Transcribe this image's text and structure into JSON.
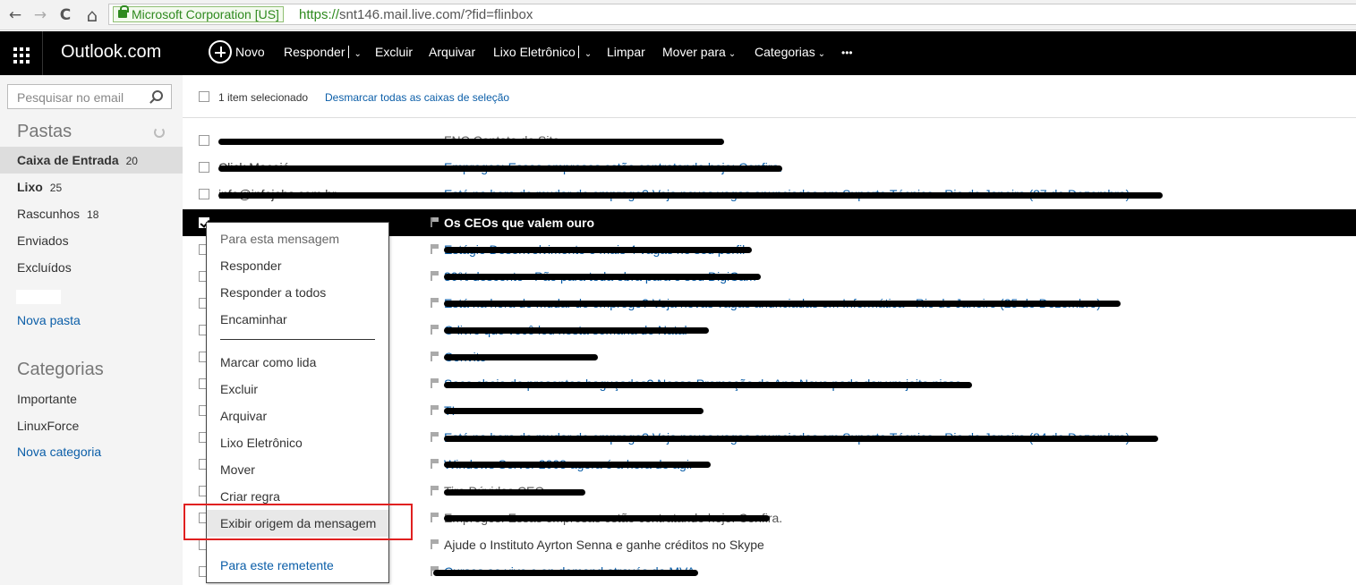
{
  "browser": {
    "back": "←",
    "forward": "→",
    "reload": "C",
    "home": "⌂",
    "secure_label": "Microsoft Corporation [US]",
    "url_scheme": "https://",
    "url_rest": "snt146.mail.live.com/?fid=flinbox"
  },
  "topbar": {
    "brand": "Outlook.com",
    "new": "Novo",
    "reply": "Responder",
    "delete": "Excluir",
    "archive": "Arquivar",
    "junk": "Lixo Eletrônico",
    "sweep": "Limpar",
    "move": "Mover para",
    "categories": "Categorias",
    "more": "•••",
    "chevron": "⌄"
  },
  "sidebar": {
    "search_placeholder": "Pesquisar no email",
    "folders_heading": "Pastas",
    "folders": [
      {
        "label": "Caixa de Entrada",
        "count": "20"
      },
      {
        "label": "Lixo",
        "count": "25"
      },
      {
        "label": "Rascunhos",
        "count": "18"
      },
      {
        "label": "Enviados",
        "count": ""
      },
      {
        "label": "Excluídos",
        "count": ""
      }
    ],
    "new_folder": "Nova pasta",
    "categories_heading": "Categorias",
    "categories": [
      "Importante",
      "LinuxForce"
    ],
    "new_category": "Nova categoria"
  },
  "list": {
    "selected_count": "1 item selecionado",
    "unselect_all": "Desmarcar todas as caixas de seleção",
    "rows": [
      {
        "sender": "",
        "subject": ""
      },
      {
        "sender": "",
        "subject": "FNC Contato do Site"
      },
      {
        "sender": "Click Maceió",
        "subject": "Empregos: Essas empresas estão contratando hoje: Confira."
      },
      {
        "sender": "info@infojobs.com.br",
        "subject": "Está na hora de mudar de emprego? Veja novas vagas anunciadas em Suporte Técnico - Rio de Janeiro (27 de Dezembro)"
      },
      {
        "sender": "",
        "subject": "Os CEOs que valem ouro"
      },
      {
        "sender": "",
        "subject": "Estágio Desenvolvimento e mais 4 vagas no seu perfil"
      },
      {
        "sender": "",
        "subject": "30% desconto - Pão para toda obra para o seu DigiCam"
      },
      {
        "sender": "",
        "subject": "Está na hora de mudar de emprego? Veja novas vagas anunciadas em Informática - Rio de Janeiro (25 de Dezembro)"
      },
      {
        "sender": "",
        "subject": "O livro que você leu nesta semana de Natal"
      },
      {
        "sender": "",
        "subject": "Convite"
      },
      {
        "sender": "",
        "subject": "Saco cheio de presentes baguçados? Nossa Promoção de Ano Novo pode dar um jeito nisso"
      },
      {
        "sender": "",
        "subject": "TI"
      },
      {
        "sender": "",
        "subject": "Está na hora de mudar de emprego? Veja novas vagas anunciadas em Suporte Técnico - Rio de Janeiro (24 de Dezembro)"
      },
      {
        "sender": "",
        "subject": "Windows Server 2003 agora é a hora de agir"
      },
      {
        "sender": "",
        "subject": "Tire Dúvidas CEO"
      },
      {
        "sender": "",
        "subject": "Empregos: Essas empresas estão contratando hoje: Confira."
      },
      {
        "sender": "",
        "subject": "Ajude o Instituto Ayrton Senna e ganhe créditos no Skype"
      },
      {
        "sender": "",
        "subject": "Cursos ao vivo e on demand através da MVA"
      }
    ]
  },
  "context_menu": {
    "heading": "Para esta mensagem",
    "items": [
      "Responder",
      "Responder a todos",
      "Encaminhar",
      "Marcar como lida",
      "Excluir",
      "Arquivar",
      "Lixo Eletrônico",
      "Mover",
      "Criar regra",
      "Exibir origem da mensagem"
    ],
    "footer": "Para este remetente"
  },
  "colors": {
    "highlight_box": "#e02020",
    "link": "#0b5ea8",
    "topbar": "#000000"
  }
}
